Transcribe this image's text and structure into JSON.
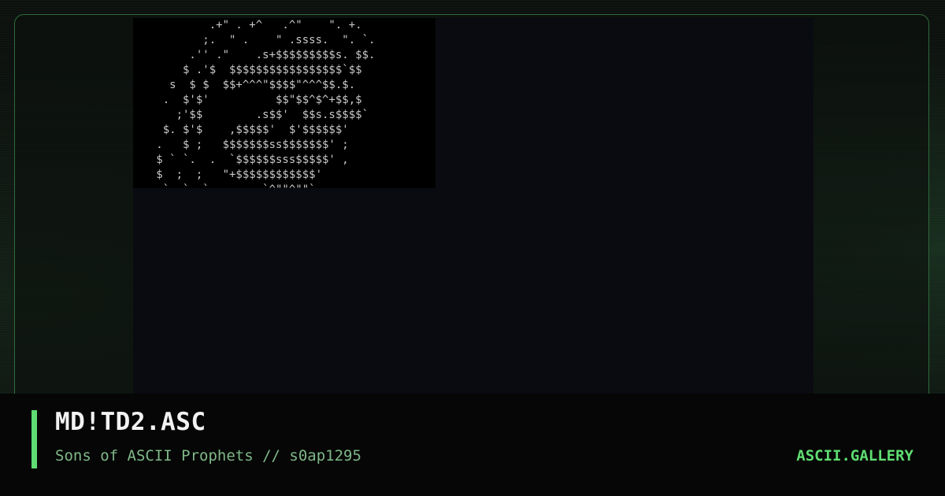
{
  "artwork": {
    "title": "MD!TD2.ASC",
    "ascii_lines": [
      "           .+\" . +^   .^\"    \". +.",
      "          ;.  \" .    \" .ssss.  \". `.",
      "        .'' .\"    .s+$$$$$$$$$s. $$.",
      "       $ .'$  $$$$$$$$$$$$$$$$$`$$",
      "     s  $ $  $$+^^^\"$$$$\"^^^$$.$.",
      "    .  $'$'          $$\"$$^$^+$$,$",
      "      ;'$$        .s$$'  $$s.s$$$$`",
      "    $. $'$    ,$$$$$'  $'$$$$$$'",
      "   .   $ ;   $$$$$$$ss$$$$$$$' ;",
      "   $ ` `.  .  `$$$$$$sss$$$$$' ,",
      "   $  ;  ;   \"+$$$$$$$$$$$$'",
      "    `  `  `        `^\"\"^\"\"`"
    ]
  },
  "footer": {
    "title": "MD!TD2.ASC",
    "subtitle": "Sons of ASCII Prophets // s0ap1295",
    "brand": "ASCII.GALLERY"
  },
  "colors": {
    "accent": "#5fdc72",
    "frame_border": "#2f6b3c",
    "subtitle": "#7fb889",
    "title": "#f2f2f2"
  }
}
